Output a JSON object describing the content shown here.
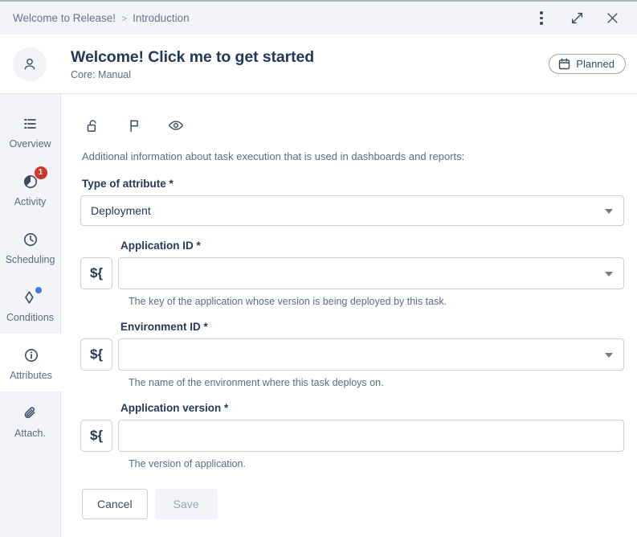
{
  "breadcrumb": {
    "items": [
      "Welcome to Release!",
      "Introduction"
    ],
    "separator": ">"
  },
  "window_actions": {
    "menu_label": "More options",
    "expand_label": "Expand",
    "close_label": "Close"
  },
  "header": {
    "title": "Welcome! Click me to get started",
    "subtitle": "Core: Manual",
    "status_badge": "Planned",
    "avatar_icon": "person-icon"
  },
  "sidebar": {
    "items": [
      {
        "label": "Overview",
        "icon": "list-icon",
        "selected": false
      },
      {
        "label": "Activity",
        "icon": "pie-chart-icon",
        "selected": false,
        "badge": "1"
      },
      {
        "label": "Scheduling",
        "icon": "clock-icon",
        "selected": false
      },
      {
        "label": "Conditions",
        "icon": "diamond-icon",
        "selected": false,
        "dot": true
      },
      {
        "label": "Attributes",
        "icon": "info-circle-icon",
        "selected": true
      },
      {
        "label": "Attach.",
        "icon": "paperclip-icon",
        "selected": false
      }
    ]
  },
  "toolbar": {
    "buttons": [
      {
        "name": "unlock-icon",
        "label": "Lock task"
      },
      {
        "name": "flag-icon",
        "label": "Flag task"
      },
      {
        "name": "eye-icon",
        "label": "Watch task"
      }
    ]
  },
  "main": {
    "description": "Additional information about task execution that is used in dashboards and reports:",
    "type_field": {
      "label": "Type of attribute *",
      "value": "Deployment",
      "options": [
        "Deployment"
      ]
    },
    "fields": [
      {
        "label": "Application ID *",
        "value": "",
        "placeholder": "",
        "hint": "The key of the application whose version is being deployed by this task.",
        "var_button": "${",
        "has_dropdown": true
      },
      {
        "label": "Environment ID *",
        "value": "",
        "placeholder": "",
        "hint": "The name of the environment where this task deploys on.",
        "var_button": "${",
        "has_dropdown": true
      },
      {
        "label": "Application version *",
        "value": "",
        "placeholder": "",
        "hint": "The version of application.",
        "var_button": "${",
        "has_dropdown": false
      }
    ],
    "actions": {
      "cancel_label": "Cancel",
      "save_label": "Save",
      "save_disabled": true
    }
  },
  "colors": {
    "accent": "#253858",
    "muted": "#5d6b82",
    "panel": "#f2f4f7",
    "border": "#c9ced8",
    "badge_red": "#d0342c",
    "dot_blue": "#3d7dd6"
  }
}
